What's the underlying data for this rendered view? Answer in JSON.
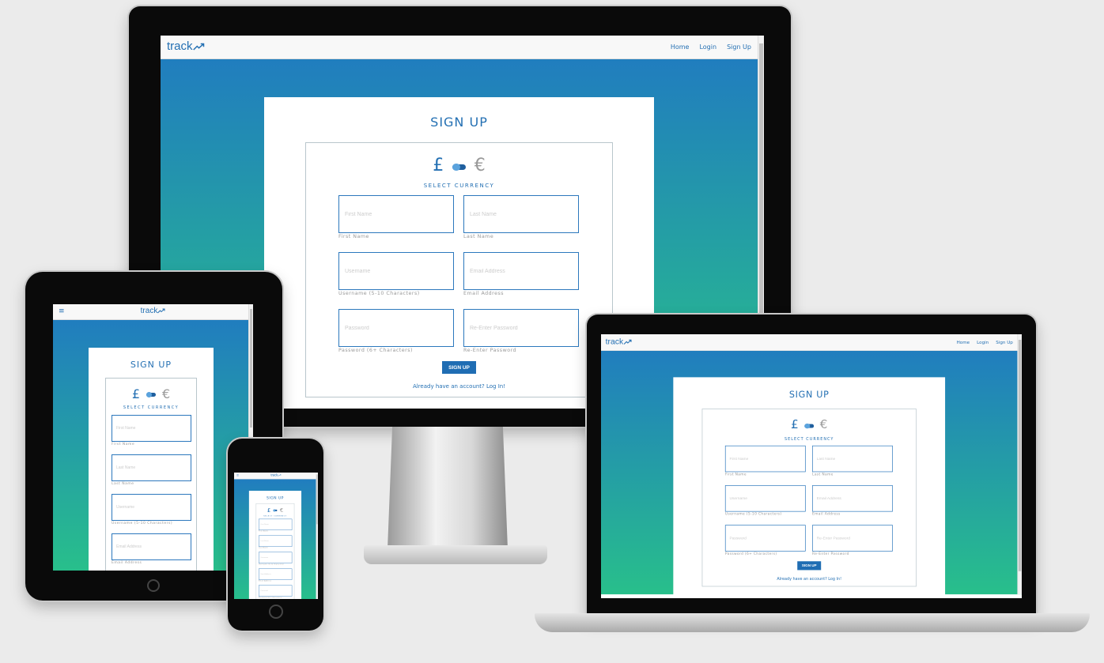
{
  "brand": "track",
  "nav": {
    "links": [
      "Home",
      "Login",
      "Sign Up"
    ],
    "menu_icon": "hamburger-icon"
  },
  "form": {
    "title": "SIGN UP",
    "currency": {
      "left": "£",
      "right": "€",
      "label": "SELECT CURRENCY"
    },
    "fields": [
      {
        "placeholder": "First Name",
        "label": "First Name"
      },
      {
        "placeholder": "Last Name",
        "label": "Last Name"
      },
      {
        "placeholder": "Username",
        "label": "Username (5-10 Characters)"
      },
      {
        "placeholder": "Email Address",
        "label": "Email Address"
      },
      {
        "placeholder": "Password",
        "label": "Password (6+ Characters)"
      },
      {
        "placeholder": "Re-Enter Password",
        "label": "Re-Enter Password"
      }
    ],
    "submit": "SIGN UP",
    "login_link": "Already have an account? Log In!"
  },
  "colors": {
    "primary": "#2470b3",
    "gradient_top": "#2079c2",
    "gradient_bottom": "#28bf8b",
    "button": "#1f6db3"
  }
}
